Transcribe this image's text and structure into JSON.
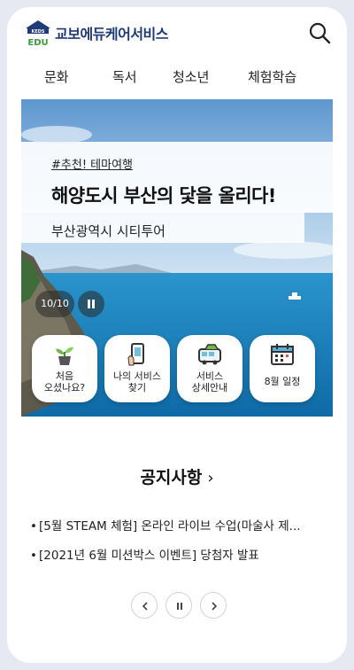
{
  "header": {
    "logo_badge": "KEDS",
    "logo_sub": "EDU",
    "logo_text": "교보에듀케어서비스",
    "search_icon": "search-icon"
  },
  "nav": {
    "items": [
      {
        "label": "문화"
      },
      {
        "label": "독서"
      },
      {
        "label": "청소년"
      },
      {
        "label": "체험학습"
      }
    ]
  },
  "hero": {
    "tag": "#추천! 테마여행",
    "title": "해양도시 부산의 닻을 올리다!",
    "subtitle": "부산광역시 시티투어",
    "counter": "10/10",
    "colors": {
      "sky": "#7fb3dc",
      "sea": "#1a7fb8"
    }
  },
  "quick_menu": [
    {
      "label": "처음\n오셨나요?",
      "icon": "plant-icon"
    },
    {
      "label": "나의 서비스\n찾기",
      "icon": "phone-icon"
    },
    {
      "label": "서비스\n상세안내",
      "icon": "bus-icon"
    },
    {
      "label": "8월 일정",
      "icon": "calendar-icon"
    }
  ],
  "notice": {
    "title": "공지사항",
    "chevron": "›",
    "items": [
      {
        "text": "[5월 STEAM 체험] 온라인 라이브 수업(마술사 제..."
      },
      {
        "text": "[2021년 6월 미션박스 이벤트] 당첨자 발표"
      }
    ]
  },
  "brand_color": "#1f3a78"
}
